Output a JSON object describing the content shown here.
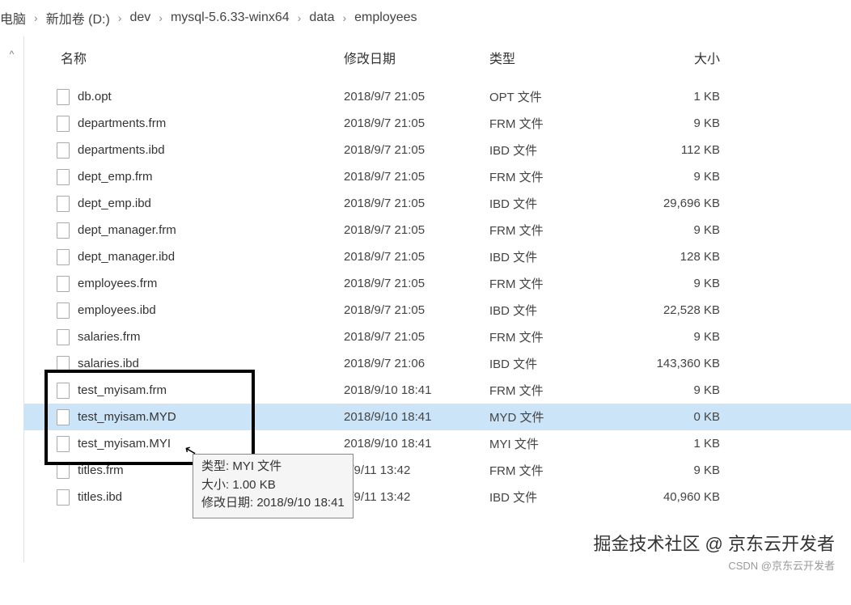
{
  "breadcrumb": [
    "电脑",
    "新加卷 (D:)",
    "dev",
    "mysql-5.6.33-winx64",
    "data",
    "employees"
  ],
  "headers": {
    "name": "名称",
    "date": "修改日期",
    "type": "类型",
    "size": "大小"
  },
  "left_caret": "^",
  "files": [
    {
      "name": "db.opt",
      "date": "2018/9/7 21:05",
      "type": "OPT 文件",
      "size": "1 KB",
      "selected": false
    },
    {
      "name": "departments.frm",
      "date": "2018/9/7 21:05",
      "type": "FRM 文件",
      "size": "9 KB",
      "selected": false
    },
    {
      "name": "departments.ibd",
      "date": "2018/9/7 21:05",
      "type": "IBD 文件",
      "size": "112 KB",
      "selected": false
    },
    {
      "name": "dept_emp.frm",
      "date": "2018/9/7 21:05",
      "type": "FRM 文件",
      "size": "9 KB",
      "selected": false
    },
    {
      "name": "dept_emp.ibd",
      "date": "2018/9/7 21:05",
      "type": "IBD 文件",
      "size": "29,696 KB",
      "selected": false
    },
    {
      "name": "dept_manager.frm",
      "date": "2018/9/7 21:05",
      "type": "FRM 文件",
      "size": "9 KB",
      "selected": false
    },
    {
      "name": "dept_manager.ibd",
      "date": "2018/9/7 21:05",
      "type": "IBD 文件",
      "size": "128 KB",
      "selected": false
    },
    {
      "name": "employees.frm",
      "date": "2018/9/7 21:05",
      "type": "FRM 文件",
      "size": "9 KB",
      "selected": false
    },
    {
      "name": "employees.ibd",
      "date": "2018/9/7 21:05",
      "type": "IBD 文件",
      "size": "22,528 KB",
      "selected": false
    },
    {
      "name": "salaries.frm",
      "date": "2018/9/7 21:05",
      "type": "FRM 文件",
      "size": "9 KB",
      "selected": false
    },
    {
      "name": "salaries.ibd",
      "date": "2018/9/7 21:06",
      "type": "IBD 文件",
      "size": "143,360 KB",
      "selected": false
    },
    {
      "name": "test_myisam.frm",
      "date": "2018/9/10 18:41",
      "type": "FRM 文件",
      "size": "9 KB",
      "selected": false
    },
    {
      "name": "test_myisam.MYD",
      "date": "2018/9/10 18:41",
      "type": "MYD 文件",
      "size": "0 KB",
      "selected": true
    },
    {
      "name": "test_myisam.MYI",
      "date": "2018/9/10 18:41",
      "type": "MYI 文件",
      "size": "1 KB",
      "selected": false
    },
    {
      "name": "titles.frm",
      "date": "8/9/11 13:42",
      "type": "FRM 文件",
      "size": "9 KB",
      "selected": false
    },
    {
      "name": "titles.ibd",
      "date": "8/9/11 13:42",
      "type": "IBD 文件",
      "size": "40,960 KB",
      "selected": false
    }
  ],
  "tooltip": {
    "line1": "类型: MYI 文件",
    "line2": "大小: 1.00 KB",
    "line3": "修改日期: 2018/9/10 18:41"
  },
  "watermark": {
    "line1": "掘金技术社区 @ 京东云开发者",
    "line2": "CSDN @京东云开发者"
  }
}
